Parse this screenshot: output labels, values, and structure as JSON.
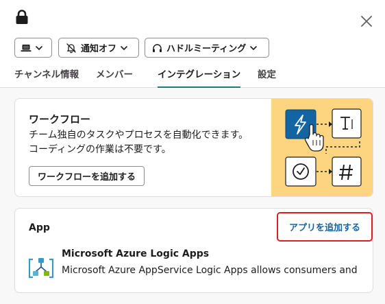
{
  "header": {
    "lock_icon": "lock-icon",
    "close_icon": "close-icon"
  },
  "controls": {
    "device": {
      "icon": "laptop-icon",
      "chevron": "chevron-down-icon"
    },
    "notification": {
      "label": "通知オフ",
      "icon": "bell-off-icon"
    },
    "huddle": {
      "label": "ハドルミーティング",
      "icon": "headphones-icon"
    }
  },
  "tabs": [
    {
      "label": "チャンネル情報",
      "active": false
    },
    {
      "label": "メンバー",
      "active": false
    },
    {
      "label": "インテグレーション",
      "active": true
    },
    {
      "label": "設定",
      "active": false
    }
  ],
  "workflow": {
    "title": "ワークフロー",
    "description": "チーム独自のタスクやプロセスを自動化できます。コーディングの作業は不要です。",
    "button_label": "ワークフローを追加する",
    "illustration_bg": "#fdd580",
    "illustration_icons": [
      "lightning-icon",
      "text-box-icon",
      "check-circle-icon",
      "hash-icon",
      "hand-pointer-icon"
    ]
  },
  "apps": {
    "title": "App",
    "add_label": "アプリを追加する",
    "items": [
      {
        "name": "Microsoft Azure Logic Apps",
        "description": "Microsoft Azure AppService Logic Apps allows consumers and"
      }
    ]
  },
  "colors": {
    "accent_tab": "#1c7b72",
    "link": "#1264a3",
    "highlight": "#e01e1e",
    "workflow_primary": "#1264a3"
  }
}
